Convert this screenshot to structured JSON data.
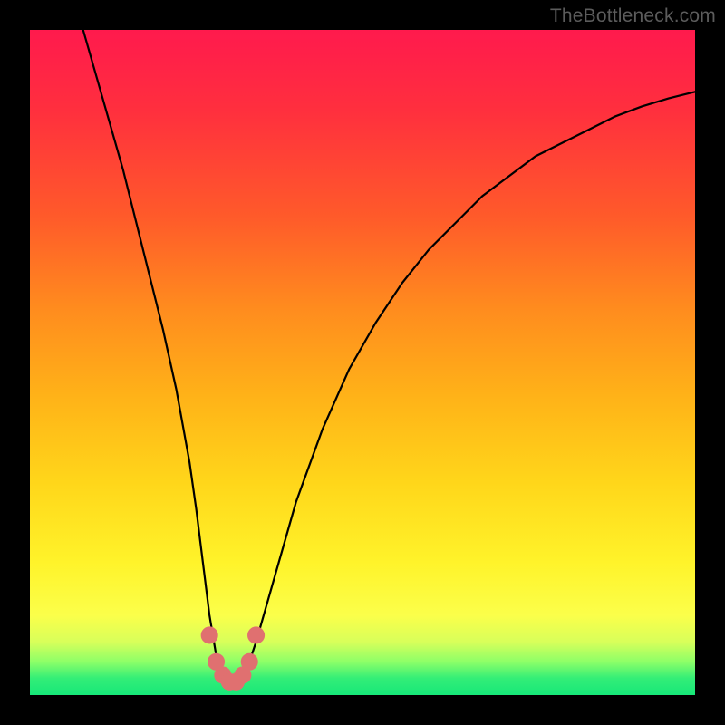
{
  "watermark": "TheBottleneck.com",
  "chart_data": {
    "type": "line",
    "title": "",
    "xlabel": "",
    "ylabel": "",
    "xlim": [
      0,
      100
    ],
    "ylim": [
      0,
      100
    ],
    "grid": false,
    "legend": false,
    "series": [
      {
        "name": "bottleneck-curve",
        "color": "#000000",
        "x": [
          8,
          10,
          12,
          14,
          16,
          18,
          20,
          22,
          24,
          25,
          26,
          27,
          28,
          29,
          30,
          31,
          32,
          33,
          34,
          36,
          38,
          40,
          44,
          48,
          52,
          56,
          60,
          64,
          68,
          72,
          76,
          80,
          84,
          88,
          92,
          96,
          100
        ],
        "y": [
          100,
          93,
          86,
          79,
          71,
          63,
          55,
          46,
          35,
          28,
          20,
          12,
          6,
          3,
          2,
          2,
          3,
          5,
          8,
          15,
          22,
          29,
          40,
          49,
          56,
          62,
          67,
          71,
          75,
          78,
          81,
          83,
          85,
          87,
          88.5,
          89.7,
          90.7
        ]
      }
    ],
    "markers": [
      {
        "name": "trough-marker",
        "x": 27,
        "y": 9,
        "r": 1.3,
        "color": "#e07070"
      },
      {
        "name": "trough-marker",
        "x": 28,
        "y": 5,
        "r": 1.3,
        "color": "#e07070"
      },
      {
        "name": "trough-marker",
        "x": 29,
        "y": 3,
        "r": 1.3,
        "color": "#e07070"
      },
      {
        "name": "trough-marker",
        "x": 30,
        "y": 2,
        "r": 1.3,
        "color": "#e07070"
      },
      {
        "name": "trough-marker",
        "x": 31,
        "y": 2,
        "r": 1.3,
        "color": "#e07070"
      },
      {
        "name": "trough-marker",
        "x": 32,
        "y": 3,
        "r": 1.3,
        "color": "#e07070"
      },
      {
        "name": "trough-marker",
        "x": 33,
        "y": 5,
        "r": 1.3,
        "color": "#e07070"
      },
      {
        "name": "trough-marker",
        "x": 34,
        "y": 9,
        "r": 1.3,
        "color": "#e07070"
      }
    ],
    "background_gradient_stops": [
      {
        "pos": 0.0,
        "color": "#ff1a4d"
      },
      {
        "pos": 0.28,
        "color": "#ff5a2a"
      },
      {
        "pos": 0.55,
        "color": "#ffb218"
      },
      {
        "pos": 0.8,
        "color": "#fff32a"
      },
      {
        "pos": 0.95,
        "color": "#8dff68"
      },
      {
        "pos": 1.0,
        "color": "#17e779"
      }
    ]
  }
}
